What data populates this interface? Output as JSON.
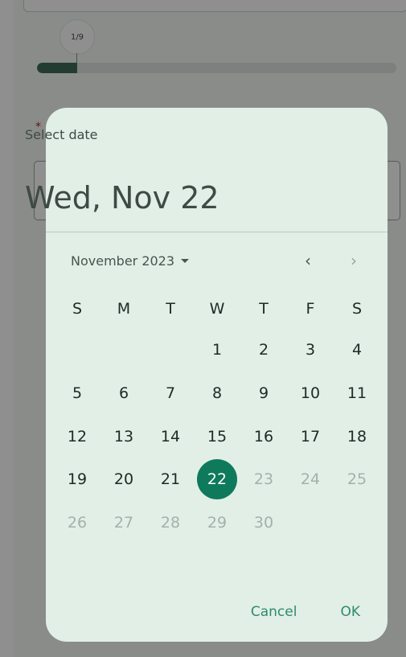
{
  "progress": {
    "label": "1/9",
    "fraction": 0.111,
    "color": "#3f6b58"
  },
  "background_form": {
    "required_marker": "*"
  },
  "dialog": {
    "headline": "Select date",
    "selected_date_text": "Wed, Nov 22",
    "month_year": "November 2023",
    "prev_icon": "chevron-left-icon",
    "next_icon": "chevron-right-icon",
    "prev_glyph": "‹",
    "next_glyph": "›",
    "weekdays": [
      "S",
      "M",
      "T",
      "W",
      "T",
      "F",
      "S"
    ],
    "weeks": [
      [
        null,
        null,
        null,
        1,
        2,
        3,
        4
      ],
      [
        5,
        6,
        7,
        8,
        9,
        10,
        11
      ],
      [
        12,
        13,
        14,
        15,
        16,
        17,
        18
      ],
      [
        19,
        20,
        21,
        22,
        23,
        24,
        25
      ],
      [
        26,
        27,
        28,
        29,
        30,
        null,
        null
      ]
    ],
    "selected_day": 22,
    "last_enabled_day": 22,
    "cancel_label": "Cancel",
    "ok_label": "OK",
    "colors": {
      "accent": "#0e7a5b",
      "surface": "#e1efe7",
      "disabled_text": "#a5b0aa"
    }
  }
}
